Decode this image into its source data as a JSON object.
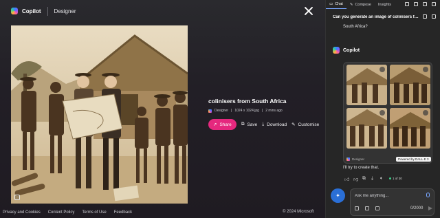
{
  "header": {
    "brand": "Copilot",
    "product": "Designer"
  },
  "image": {
    "title": "colinisers from South Africa",
    "creator": "Designer",
    "dimensions": "1024 x 1024 jpg",
    "age": "2 mins ago"
  },
  "actions": {
    "share": "Share",
    "save": "Save",
    "download": "Download",
    "customise": "Customise"
  },
  "footer": {
    "links": [
      "Privacy and Cookies",
      "Content Policy",
      "Terms of Use",
      "Feedback"
    ],
    "copyright": "© 2024 Microsoft"
  },
  "panel": {
    "tabs": [
      "Chat",
      "Compose",
      "Insights"
    ],
    "chat_title": "Can you generate an image of colinisers fr...",
    "user_message_tail": "South Africa?",
    "bot_name": "Copilot",
    "designer_tag": "Designer",
    "powered_by": "Powered by DALL·E 3",
    "reply": "I'll try to create that.",
    "turn_count": "1 of 30",
    "input_placeholder": "Ask me anything...",
    "char_count": "0/2000"
  },
  "colors": {
    "accent_pink": "#e5287e",
    "accent_blue": "#2a6fd6",
    "panel_bg": "#262626"
  }
}
